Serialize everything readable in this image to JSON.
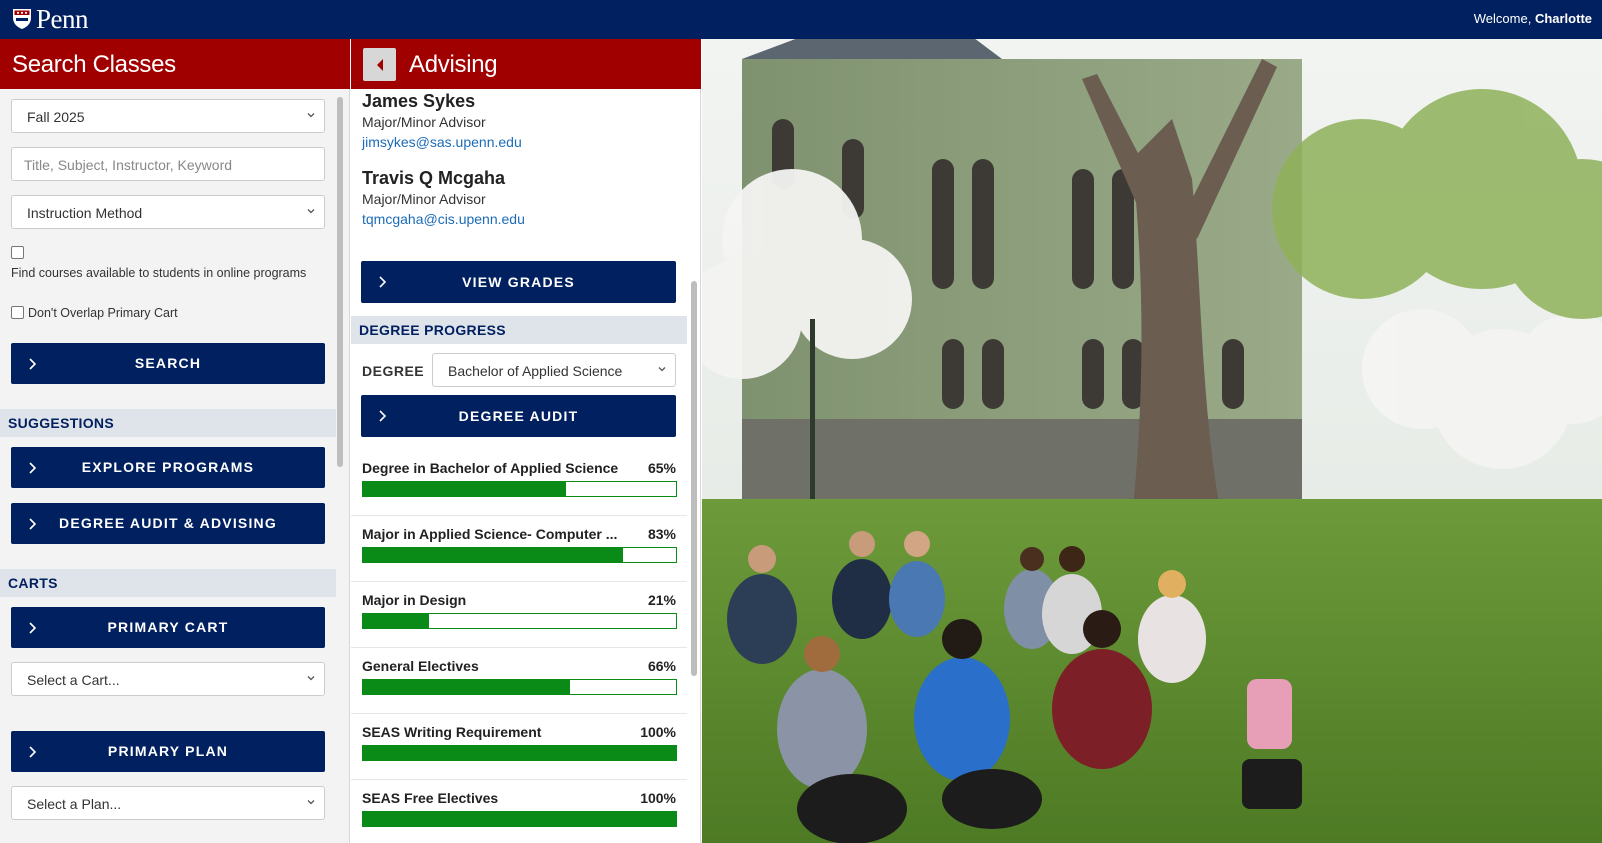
{
  "topbar": {
    "logo_text": "Penn",
    "welcome_prefix": "Welcome, ",
    "user_name": "Charlotte"
  },
  "search_panel": {
    "title": "Search Classes",
    "term_select": "Fall 2025",
    "search_placeholder": "Title, Subject, Instructor, Keyword",
    "instruction_select": "Instruction Method",
    "online_checkbox_label": "Find courses available to students in online programs",
    "overlap_checkbox_label": "Don't Overlap Primary Cart",
    "search_button": "SEARCH",
    "suggestions_heading": "SUGGESTIONS",
    "explore_button": "EXPLORE PROGRAMS",
    "audit_advising_button": "DEGREE AUDIT & ADVISING",
    "carts_heading": "CARTS",
    "primary_cart_button": "PRIMARY CART",
    "cart_select": "Select a Cart...",
    "primary_plan_button": "PRIMARY PLAN",
    "plan_select": "Select a Plan..."
  },
  "advising_panel": {
    "title": "Advising",
    "advisors": [
      {
        "name": "James Sykes",
        "role": "Major/Minor Advisor",
        "email": "jimsykes@sas.upenn.edu"
      },
      {
        "name": "Travis Q Mcgaha",
        "role": "Major/Minor Advisor",
        "email": "tqmcgaha@cis.upenn.edu"
      }
    ],
    "view_grades_button": "VIEW GRADES",
    "degree_progress_heading": "DEGREE PROGRESS",
    "degree_label": "DEGREE",
    "degree_select": "Bachelor of Applied Science",
    "degree_audit_button": "DEGREE AUDIT",
    "progress": [
      {
        "label": "Degree in Bachelor of Applied Science",
        "pct_text": "65%",
        "value": 65
      },
      {
        "label": "Major in Applied Science- Computer ...",
        "pct_text": "83%",
        "value": 83
      },
      {
        "label": "Major in Design",
        "pct_text": "21%",
        "value": 21
      },
      {
        "label": "General Electives",
        "pct_text": "66%",
        "value": 66
      },
      {
        "label": "SEAS Writing Requirement",
        "pct_text": "100%",
        "value": 100
      },
      {
        "label": "SEAS Free Electives",
        "pct_text": "100%",
        "value": 100
      }
    ]
  },
  "colors": {
    "navy": "#01205f",
    "header_red": "#a10000",
    "progress_green": "#0a8a16",
    "link_blue": "#1c6bb8"
  }
}
